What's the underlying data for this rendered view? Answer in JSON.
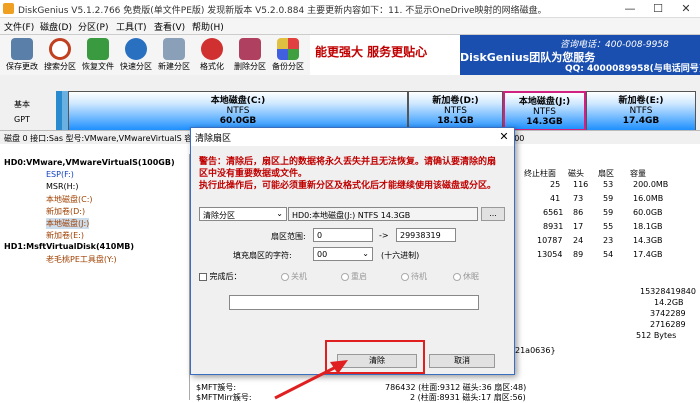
{
  "window": {
    "title": "DiskGenius V5.1.2.766 免费版(单文件PE版)  发现新版本 V5.2.0.884 主要更新内容如下：11. 不显示OneDrive映射的网络磁盘。",
    "min": "—",
    "max": "☐",
    "close": "✕"
  },
  "menu": [
    "文件(F)",
    "磁盘(D)",
    "分区(P)",
    "工具(T)",
    "查看(V)",
    "帮助(H)"
  ],
  "toolbar": [
    "保存更改",
    "搜索分区",
    "恢复文件",
    "快速分区",
    "新建分区",
    "格式化",
    "删除分区",
    "备份分区"
  ],
  "banner": {
    "slogan": "能更强大 服务更贴心",
    "brand": "DiskGenius团队为您服务",
    "phone": "咨询电话：400-008-9958",
    "qq": "QQ: 4000089958(与电话同号)"
  },
  "diskpanel": {
    "label1": "基本",
    "label2": "GPT",
    "partitions": [
      {
        "name": "本地磁盘(C:)",
        "fs": "NTFS",
        "size": "60.0GB"
      },
      {
        "name": "新加卷(D:)",
        "fs": "NTFS",
        "size": "18.1GB"
      },
      {
        "name": "本地磁盘(J:)",
        "fs": "NTFS",
        "size": "14.3GB"
      },
      {
        "name": "新加卷(E:)",
        "fs": "NTFS",
        "size": "17.4GB"
      }
    ]
  },
  "infoline": "磁盘 0 接口:Sas  型号:VMware,VMwareVirtualS  容量:110.0GB(112640MB)  柱面数:14359  磁头数:255  每道扇区数:63  总扇区数:229715200",
  "tree": [
    "HD0:VMware,VMwareVirtualS(100GB)",
    "ESP(F:)",
    "MSR(H:)",
    "本地磁盘(C:)",
    "新加卷(D:)",
    "本地磁盘(J:)",
    "新加卷(E:)",
    "HD1:MsftVirtualDisk(410MB)",
    "老毛桃PE工具盘(Y:)"
  ],
  "table": {
    "headers": [
      "终止柱面",
      "磁头",
      "扇区",
      "容量"
    ],
    "rows": [
      [
        "25",
        "116",
        "53",
        "200.0MB"
      ],
      [
        "41",
        "73",
        "59",
        "16.0MB"
      ],
      [
        "6561",
        "86",
        "59",
        "60.0GB"
      ],
      [
        "8931",
        "17",
        "55",
        "18.1GB"
      ],
      [
        "10787",
        "24",
        "23",
        "14.3GB"
      ],
      [
        "13054",
        "89",
        "54",
        "17.4GB"
      ],
      [
        "",
        "",
        "",
        ""
      ]
    ]
  },
  "details": {
    "right_values": [
      "15328419840",
      "14.2GB",
      "3742289",
      "2716289",
      "512 Bytes"
    ],
    "guid_tail": "21a0636}",
    "rows": [
      {
        "label": "$MFT簇号:",
        "value": "786432 (柱面:9312 磁头:36 扇区:48)"
      },
      {
        "label": "$MFTMirr簇号:",
        "value": "2 (柱面:8931 磁头:17 扇区:56)"
      }
    ]
  },
  "dialog": {
    "title": "清除扇区",
    "close": "✕",
    "warning": [
      "警告：清除后，扇区上的数据将永久丢失并且无法恢复。请确认要清除的扇",
      "区中没有重要数据或文件。",
      "执行此操作后，可能必须重新分区及格式化后才能继续使用该磁盘或分区。"
    ],
    "mode": "清除分区",
    "target": "HD0:本地磁盘(J:) NTFS 14.3GB",
    "browse": "...",
    "range_label": "扇区范围:",
    "range_from": "0",
    "range_arrow": "->",
    "range_to": "29938319",
    "fill_label": "填充扇区的字符:",
    "fill_value": "00",
    "fill_hint": "(十六进制)",
    "after_label": "完成后：",
    "after_options": [
      "关机",
      "重启",
      "待机",
      "休眠"
    ],
    "clear_button": "清除",
    "cancel_button": "取消"
  },
  "colors": {
    "accent": "#1a4fb0",
    "warning": "#c00000",
    "highlight": "#e02020",
    "partition": "#1e90ff"
  }
}
